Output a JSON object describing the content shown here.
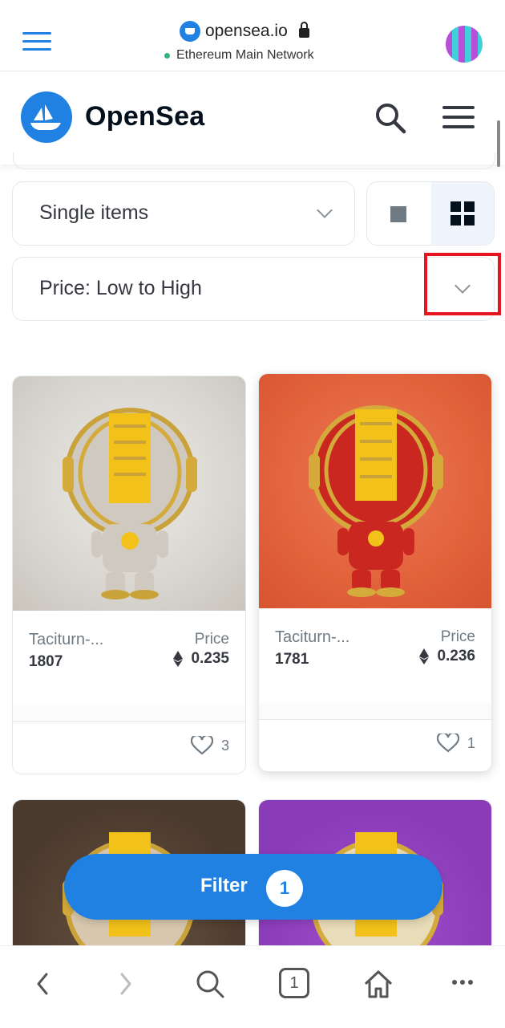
{
  "browser": {
    "url": "opensea.io",
    "network": "Ethereum Main Network"
  },
  "header": {
    "brand": "OpenSea"
  },
  "controls": {
    "item_type": "Single items",
    "sort": "Price: Low to High"
  },
  "cards": [
    {
      "name": "Taciturn-...",
      "number": "1807",
      "price_label": "Price",
      "price": "0.235",
      "likes": "3",
      "bg": "#d9d6d0"
    },
    {
      "name": "Taciturn-...",
      "number": "1781",
      "price_label": "Price",
      "price": "0.236",
      "likes": "1",
      "bg": "#e2623b"
    },
    {
      "bg": "#4b3a2e"
    },
    {
      "bg": "#8a3bb8"
    }
  ],
  "filter": {
    "label": "Filter",
    "count": "1"
  },
  "bottom_nav": {
    "tabs_count": "1"
  },
  "colors": {
    "accent": "#2081e2",
    "highlight": "#e8141d"
  }
}
